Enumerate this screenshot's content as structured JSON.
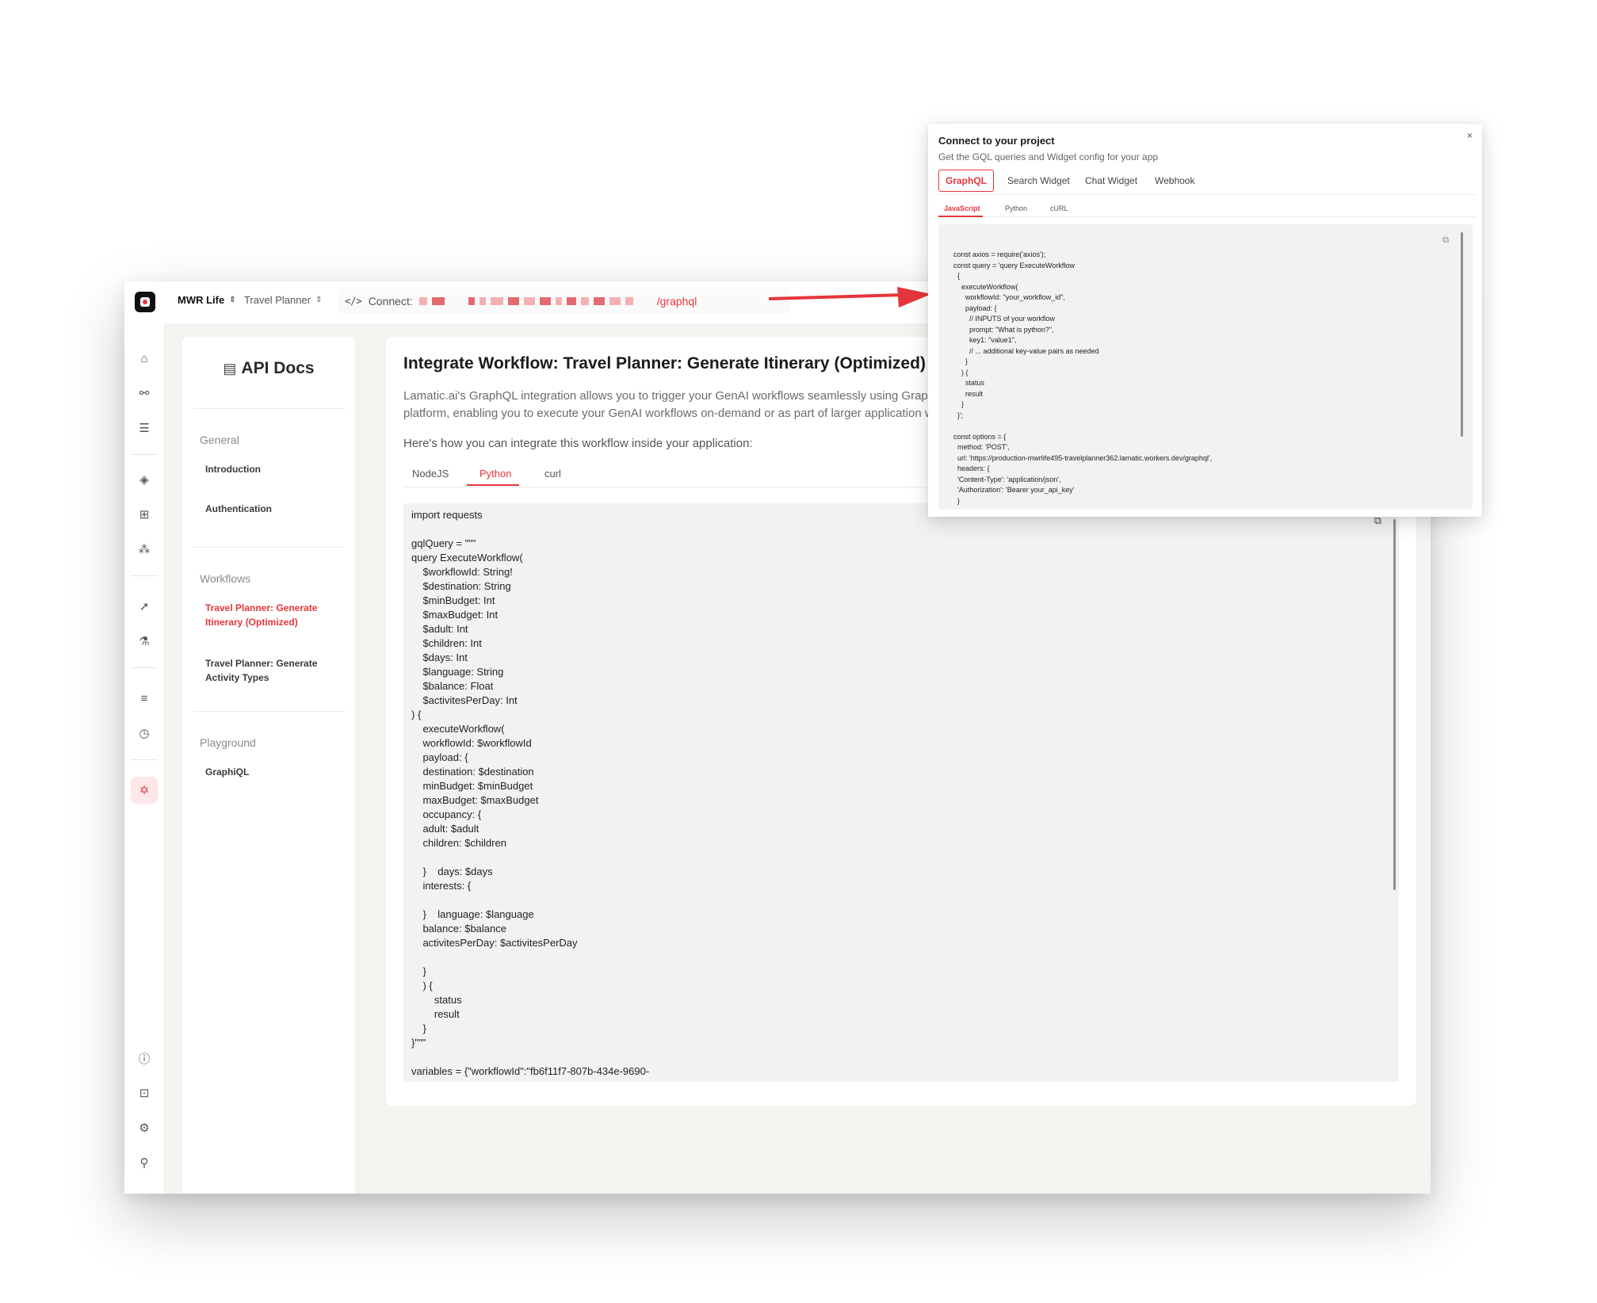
{
  "app": {
    "breadcrumb": {
      "org": "MWR Life",
      "project": "Travel Planner"
    },
    "connect": {
      "label": "Connect:",
      "url_suffix": "/graphql"
    }
  },
  "sidebar": {
    "icons": [
      "home-icon",
      "flows-icon",
      "database-icon",
      "cube-icon",
      "apps-icon",
      "models-icon",
      "rocket-icon",
      "flask-icon",
      "list-icon",
      "clock-icon",
      "graphql-icon",
      "help-icon",
      "gift-icon",
      "settings-icon",
      "user-icon"
    ],
    "active": "graphql-icon"
  },
  "doc_nav": {
    "title": "API Docs",
    "sections": [
      {
        "label": "General",
        "items": [
          "Introduction",
          "Authentication"
        ]
      },
      {
        "label": "Workflows",
        "items": [
          "Travel Planner: Generate Itinerary (Optimized)",
          "Travel Planner: Generate Activity Types"
        ]
      },
      {
        "label": "Playground",
        "items": [
          "GraphiQL"
        ]
      }
    ],
    "active_item": "Travel Planner: Generate Itinerary (Optimized)"
  },
  "content": {
    "title": "Integrate Workflow: Travel Planner: Generate Itinerary (Optimized)",
    "description_lines": [
      "Lamatic.ai's GraphQL integration allows you to trigger your GenAI workflows seamlessly using GraphQL",
      "platform, enabling you to execute your GenAI workflows on-demand or as part of larger application wo"
    ],
    "how_to": "Here's how you can integrate this workflow inside your application:",
    "tabs": [
      "NodeJS",
      "Python",
      "curl"
    ],
    "active_tab": "Python",
    "code": "import requests\n\ngqlQuery = \"\"\"\nquery ExecuteWorkflow(\n    $workflowId: String!\n    $destination: String\n    $minBudget: Int\n    $maxBudget: Int\n    $adult: Int\n    $children: Int\n    $days: Int\n    $language: String\n    $balance: Float\n    $activitesPerDay: Int\n) {\n    executeWorkflow(\n    workflowId: $workflowId\n    payload: {\n    destination: $destination\n    minBudget: $minBudget\n    maxBudget: $maxBudget\n    occupancy: {\n    adult: $adult\n    children: $children\n\n    }    days: $days\n    interests: {\n\n    }    language: $language\n    balance: $balance\n    activitesPerDay: $activitesPerDay\n\n    }\n    ) {\n        status\n        result\n    }\n}\"\"\"\n\nvariables = {\"workflowId\":\"fb6f11f7-807b-434e-9690-"
  },
  "modal": {
    "title": "Connect to your project",
    "subtitle": "Get the GQL queries and Widget config for your app",
    "close": "×",
    "tabs": [
      "GraphQL",
      "Search Widget",
      "Chat Widget",
      "Webhook"
    ],
    "active_tab": "GraphQL",
    "sub_tabs": [
      "JavaScript",
      "Python",
      "cURL"
    ],
    "active_sub_tab": "JavaScript",
    "code": "const axios = require('axios');\nconst query = 'query ExecuteWorkflow\n  {\n    executeWorkflow(\n      workflowId: \"your_workflow_id\",\n      payload: {\n        // INPUTS of your workflow\n        prompt: \"What is python?\",\n        key1: \"value1\",\n        // ... additional key-value pairs as needed\n      }\n    ) {\n      status\n      result\n    }\n  }';\n\nconst options = {\n  method: 'POST',\n  url: 'https://production-mwrlife495-travelplanner362.lamatic.workers.dev/graphql',\n  headers: {\n  'Content-Type': 'application/json',\n  'Authorization': 'Bearer your_api_key'\n  }"
  },
  "colors": {
    "accent": "#e5363b",
    "accent_bg": "#fde7e8",
    "app_bg": "#f4f3f0",
    "code_bg": "#f1f2f4"
  }
}
